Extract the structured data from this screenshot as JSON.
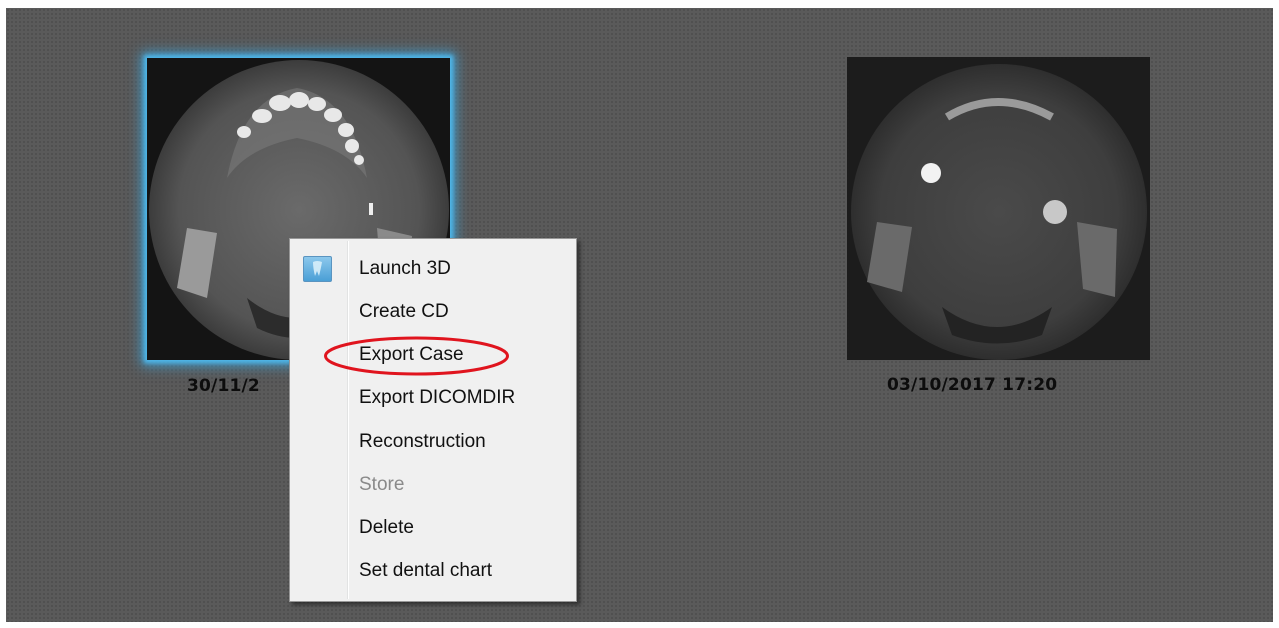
{
  "studies": [
    {
      "date": "30/11/2",
      "selected": true
    },
    {
      "date": "03/10/2017 17:20",
      "selected": false
    }
  ],
  "context_menu": {
    "icon": "3d-tooth-app-icon",
    "items": [
      {
        "label": "Launch 3D",
        "enabled": true
      },
      {
        "label": "Create CD",
        "enabled": true
      },
      {
        "label": "Export Case",
        "enabled": true,
        "circled": true
      },
      {
        "label": "Export DICOMDIR",
        "enabled": true
      },
      {
        "label": "Reconstruction",
        "enabled": true
      },
      {
        "label": "Store",
        "enabled": false
      },
      {
        "label": "Delete",
        "enabled": true
      },
      {
        "label": "Set dental chart",
        "enabled": true
      }
    ]
  },
  "colors": {
    "selection_glow": "#4fb6e8",
    "annotation_circle": "#e0141e",
    "menu_background": "#f0f0f0"
  }
}
